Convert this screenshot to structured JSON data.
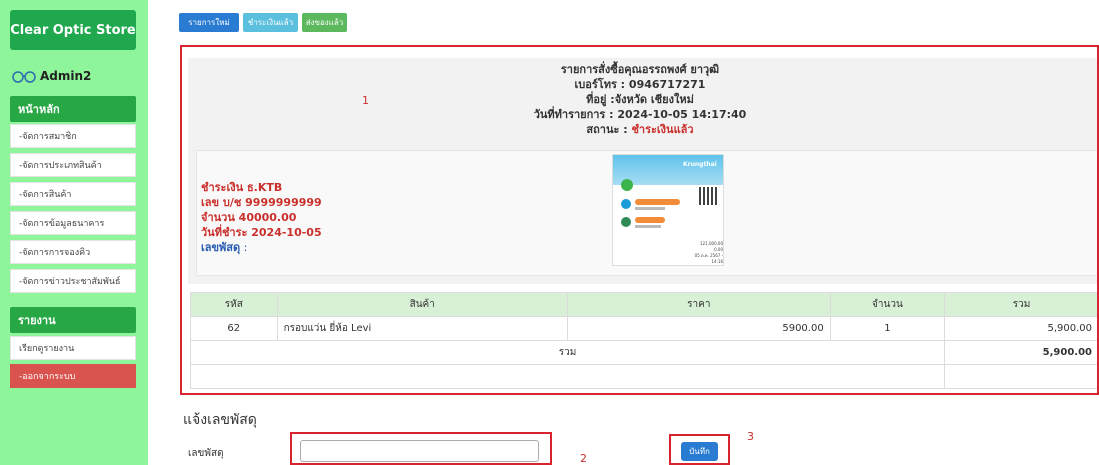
{
  "sidebar": {
    "brand": "Clear Optic Store",
    "user": "Admin2",
    "main_section": "หน้าหลัก",
    "main_items": [
      "-จัดการสมาชิก",
      "-จัดการประเภทสินค้า",
      "-จัดการสินค้า",
      "-จัดการข้อมูลธนาคาร",
      "-จัดการการจองคิว",
      "-จัดการข่าวประชาสัมพันธ์"
    ],
    "report_section": "รายงาน",
    "report_items": [
      "เรียกดูรายงาน"
    ],
    "logout": "-ออกจากระบบ"
  },
  "tabs": [
    "รายการใหม่",
    "ชำระเงินแล้ว",
    "ส่งของแล้ว"
  ],
  "annotations": {
    "n1": "1",
    "n2": "2",
    "n3": "3"
  },
  "order": {
    "customer": "รายการสั่งซื้อคุณอรรถพงศ์ ยาวุฒิ",
    "phone": "เบอร์โทร : 0946717271",
    "address": "ที่อยู่ :จังหวัด เชียงใหม่",
    "date": "วันที่ทำรายการ : 2024-10-05 14:17:40",
    "status_label": "สถานะ : ",
    "status": "ชำระเงินแล้ว"
  },
  "payment": {
    "bank": "ชำระเงิน ธ.KTB",
    "account": "เลข บ/ช 9999999999",
    "amount": "จำนวน 40000.00",
    "pay_date": "วันที่ชำระ 2024-10-05",
    "tracking_label": "เลขพัสดุ",
    "tracking_value": " :"
  },
  "slip": {
    "logo": "Krungthai",
    "amount": "121,000.00",
    "fee": "0.00",
    "date": "05 ต.ค. 2567 - 14:16"
  },
  "table": {
    "headers": [
      "รหัส",
      "สินค้า",
      "ราคา",
      "จำนวน",
      "รวม"
    ],
    "rows": [
      {
        "id": "62",
        "product": "กรอบแว่น ยี่ห้อ Levi",
        "price": "5900.00",
        "qty": "1",
        "total": "5,900.00"
      }
    ],
    "sum_label": "รวม",
    "sum_value": "5,900.00"
  },
  "tracking_form": {
    "title": "แจ้งเลขพัสดุ",
    "label": "เลขพัสดุ",
    "value": "",
    "save": "บันทึก"
  },
  "colors": {
    "sidebar": "#8ff59a",
    "brand": "#1fa84d",
    "annotation": "#d9232e",
    "status": "#c9302c"
  }
}
